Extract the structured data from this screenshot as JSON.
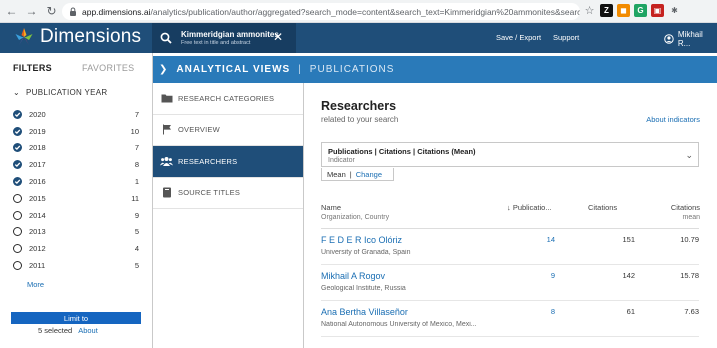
{
  "browser": {
    "url_host": "app.dimensions.ai",
    "url_rest": "/analytics/publication/author/aggregated?search_mode=content&search_text=Kimmeridgian%20ammonites&search_ty...",
    "extensions": [
      {
        "icon": "star-icon",
        "color": "#5f6368",
        "glyph": "☆"
      },
      {
        "icon": "ext-z-icon",
        "color": "#111111",
        "glyph": "Z"
      },
      {
        "icon": "ext-orange-icon",
        "color": "#f28b00",
        "glyph": "◼"
      },
      {
        "icon": "ext-green-icon",
        "color": "#1fa463",
        "glyph": "G"
      },
      {
        "icon": "ext-red-icon",
        "color": "#c5221f",
        "glyph": "▣"
      },
      {
        "icon": "puzzle-icon",
        "color": "#5f6368",
        "glyph": "✱"
      }
    ]
  },
  "header": {
    "logo_text": "Dimensions",
    "query": "Kimmeridgian ammonites",
    "query_sub": "Free text in title and abstract",
    "save_export": "Save / Export",
    "support": "Support",
    "user": "Mikhail R..."
  },
  "sidebar": {
    "tab_filters": "FILTERS",
    "tab_favorites": "FAVORITES",
    "group_title": "PUBLICATION YEAR",
    "years": [
      {
        "label": "2020",
        "count": "7",
        "checked": true
      },
      {
        "label": "2019",
        "count": "10",
        "checked": true
      },
      {
        "label": "2018",
        "count": "7",
        "checked": true
      },
      {
        "label": "2017",
        "count": "8",
        "checked": true
      },
      {
        "label": "2016",
        "count": "1",
        "checked": true
      },
      {
        "label": "2015",
        "count": "11",
        "checked": false
      },
      {
        "label": "2014",
        "count": "9",
        "checked": false
      },
      {
        "label": "2013",
        "count": "5",
        "checked": false
      },
      {
        "label": "2012",
        "count": "4",
        "checked": false
      },
      {
        "label": "2011",
        "count": "5",
        "checked": false
      }
    ],
    "more": "More",
    "limit_to": "Limit to",
    "selected": "5 selected",
    "about": "About"
  },
  "views_bar": {
    "title": "ANALYTICAL VIEWS",
    "sub": "PUBLICATIONS"
  },
  "views_nav": [
    {
      "label": "RESEARCH CATEGORIES",
      "icon": "folder-icon",
      "active": false
    },
    {
      "label": "OVERVIEW",
      "icon": "flag-icon",
      "active": false
    },
    {
      "label": "RESEARCHERS",
      "icon": "people-icon",
      "active": true
    },
    {
      "label": "SOURCE TITLES",
      "icon": "book-icon",
      "active": false
    }
  ],
  "main": {
    "title": "Researchers",
    "subtitle": "related to your search",
    "about_indicators": "About indicators",
    "indicator_title": "Publications | Citations | Citations (Mean)",
    "indicator_sub": "Indicator",
    "mean_label": "Mean",
    "change_label": "Change",
    "columns": {
      "name": "Name",
      "org": "Organization, Country",
      "pubs": "↓ Publicatio...",
      "citations": "Citations",
      "citations2": "Citations",
      "mean": "mean"
    },
    "rows": [
      {
        "name": "F E D E R Ico Olóriz",
        "org": "University of Granada, Spain",
        "pubs": "14",
        "citations": "151",
        "mean": "10.79"
      },
      {
        "name": "Mikhail A Rogov",
        "org": "Geological Institute, Russia",
        "pubs": "9",
        "citations": "142",
        "mean": "15.78"
      },
      {
        "name": "Ana Bertha Villaseñor",
        "org": "National Autonomous University of Mexico, Mexi...",
        "pubs": "8",
        "citations": "61",
        "mean": "7.63"
      }
    ]
  },
  "colors": {
    "header_bg": "#1f4e79",
    "views_bar_bg": "#2a7ab9",
    "link": "#1a6eb3",
    "limit_btn": "#1565c0"
  }
}
